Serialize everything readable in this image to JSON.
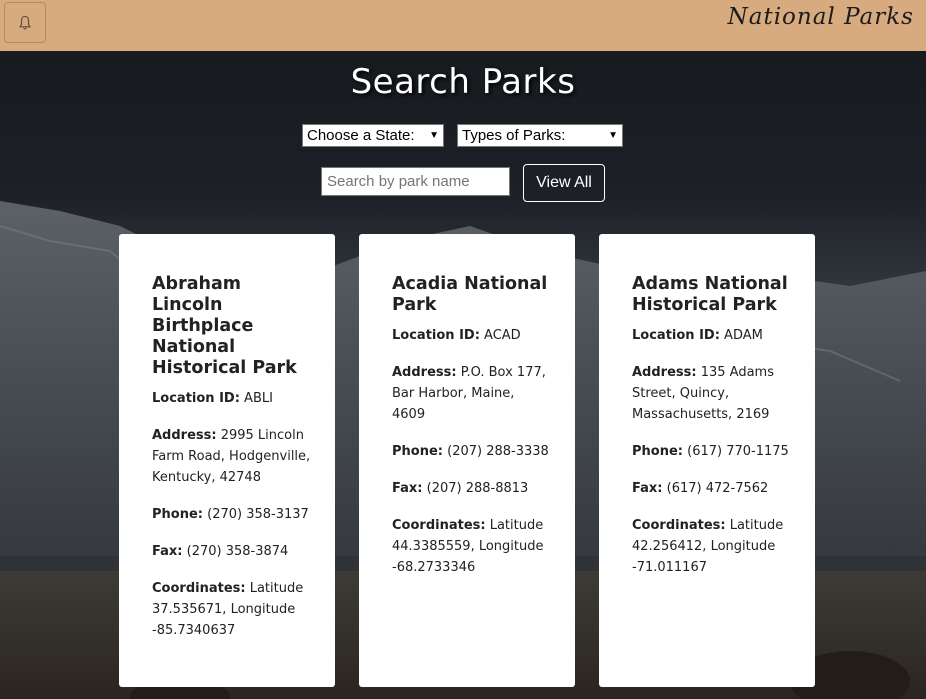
{
  "header": {
    "brand": "National Parks",
    "menu_icon": "bell-icon"
  },
  "search": {
    "title": "Search Parks",
    "state_select": "Choose a State:",
    "type_select": "Types of Parks:",
    "input_placeholder": "Search by park name",
    "input_value": "",
    "view_all_label": "View All"
  },
  "labels": {
    "location": "Location ID:",
    "address": "Address:",
    "phone": "Phone:",
    "fax": "Fax:",
    "coordinates": "Coordinates:"
  },
  "parks": [
    {
      "name": "Abraham Lincoln Birthplace National Historical Park",
      "location_id": "ABLI",
      "address": "2995 Lincoln Farm Road, Hodgenville, Kentucky, 42748",
      "phone": "(270) 358-3137",
      "fax": "(270) 358-3874",
      "coordinates": "Latitude 37.535671, Longitude -85.7340637"
    },
    {
      "name": "Acadia National Park",
      "location_id": "ACAD",
      "address": "P.O. Box 177, Bar Harbor, Maine, 4609",
      "phone": "(207) 288-3338",
      "fax": "(207) 288-8813",
      "coordinates": "Latitude 44.3385559, Longitude -68.2733346"
    },
    {
      "name": "Adams National Historical Park",
      "location_id": "ADAM",
      "address": "135 Adams Street, Quincy, Massachusetts, 2169",
      "phone": "(617) 770-1175",
      "fax": "(617) 472-7562",
      "coordinates": "Latitude 42.256412, Longitude -71.011167"
    }
  ],
  "colors": {
    "header_bg": "#d7aa80",
    "card_bg": "#ffffff",
    "title_text": "#ffffff"
  }
}
